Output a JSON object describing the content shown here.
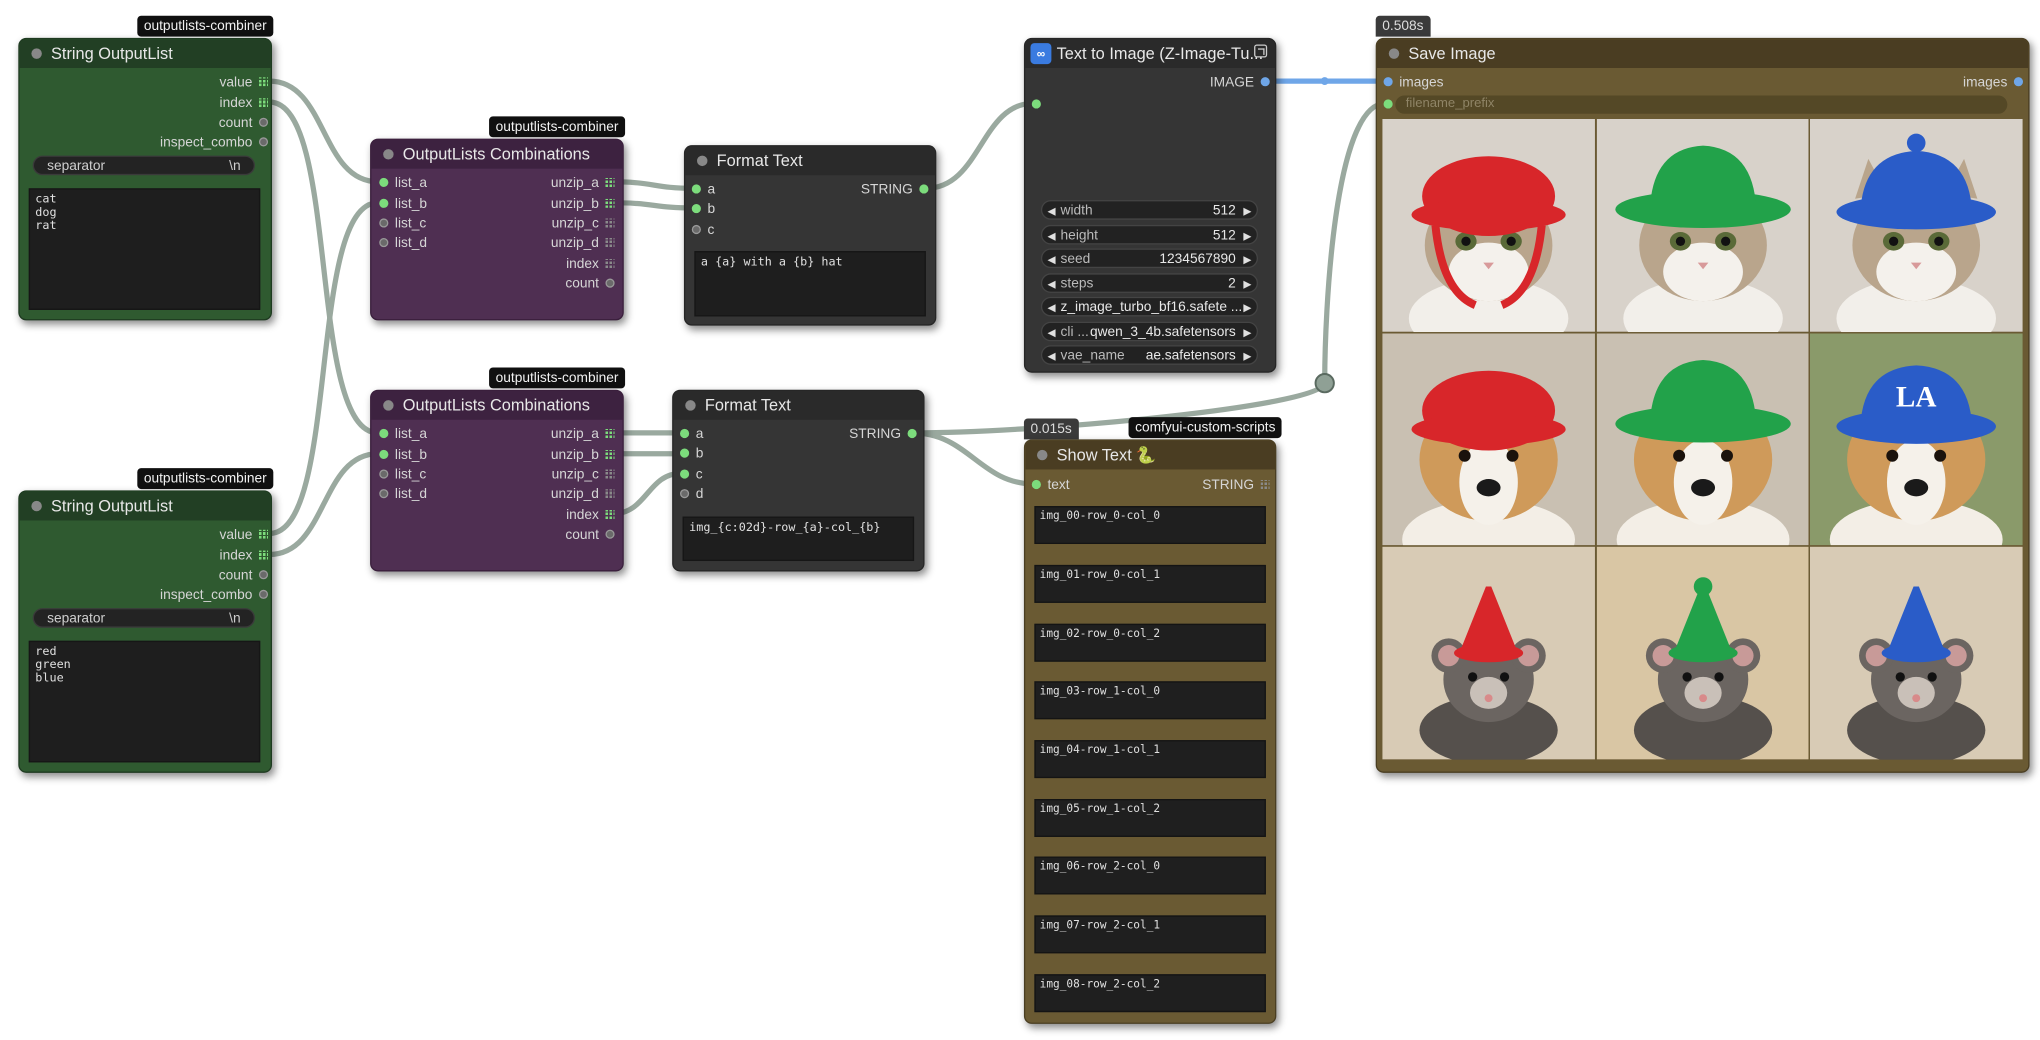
{
  "nodes": {
    "string_list_1": {
      "tag": "outputlists-combiner",
      "title": "String OutputList",
      "outputs": [
        "value",
        "index",
        "count",
        "inspect_combo"
      ],
      "separator_label": "separator",
      "separator_value": "\\n",
      "text": "cat\ndog\nrat"
    },
    "string_list_2": {
      "tag": "outputlists-combiner",
      "title": "String OutputList",
      "outputs": [
        "value",
        "index",
        "count",
        "inspect_combo"
      ],
      "separator_label": "separator",
      "separator_value": "\\n",
      "text": "red\ngreen\nblue"
    },
    "combinations_1": {
      "tag": "outputlists-combiner",
      "title": "OutputLists Combinations",
      "inputs": [
        "list_a",
        "list_b",
        "list_c",
        "list_d"
      ],
      "outputs": [
        "unzip_a",
        "unzip_b",
        "unzip_c",
        "unzip_d",
        "index",
        "count"
      ]
    },
    "combinations_2": {
      "tag": "outputlists-combiner",
      "title": "OutputLists Combinations",
      "inputs": [
        "list_a",
        "list_b",
        "list_c",
        "list_d"
      ],
      "outputs": [
        "unzip_a",
        "unzip_b",
        "unzip_c",
        "unzip_d",
        "index",
        "count"
      ]
    },
    "format_text_1": {
      "title": "Format Text",
      "inputs": [
        "a",
        "b",
        "c"
      ],
      "output": "STRING",
      "text": "a {a} with a {b} hat"
    },
    "format_text_2": {
      "title": "Format Text",
      "inputs": [
        "a",
        "b",
        "c",
        "d"
      ],
      "output": "STRING",
      "text": "img_{c:02d}-row_{a}-col_{b}"
    },
    "text_to_image": {
      "title": "Text to Image (Z-Image-Tu...",
      "output": "IMAGE",
      "widgets": [
        {
          "label": "width",
          "value": "512"
        },
        {
          "label": "height",
          "value": "512"
        },
        {
          "label": "seed",
          "value": "1234567890"
        },
        {
          "label": "steps",
          "value": "2"
        },
        {
          "label": "",
          "value": "z_image_turbo_bf16.safete ..."
        },
        {
          "label": "cli ...",
          "value": "qwen_3_4b.safetensors"
        },
        {
          "label": "vae_name",
          "value": "ae.safetensors"
        }
      ]
    },
    "show_text": {
      "time": "0.015s",
      "tag": "comfyui-custom-scripts",
      "title": "Show Text",
      "input": "text",
      "output": "STRING",
      "entries": [
        "img_00-row_0-col_0",
        "img_01-row_0-col_1",
        "img_02-row_0-col_2",
        "img_03-row_1-col_0",
        "img_04-row_1-col_1",
        "img_05-row_1-col_2",
        "img_06-row_2-col_0",
        "img_07-row_2-col_1",
        "img_08-row_2-col_2"
      ]
    },
    "save_image": {
      "time": "0.508s",
      "title": "Save Image",
      "input": "images",
      "output": "images",
      "prefix_placeholder": "filename_prefix",
      "images": [
        {
          "animal": "cat",
          "hat": "red"
        },
        {
          "animal": "cat",
          "hat": "green"
        },
        {
          "animal": "cat",
          "hat": "blue"
        },
        {
          "animal": "dog",
          "hat": "red"
        },
        {
          "animal": "dog",
          "hat": "green"
        },
        {
          "animal": "dog",
          "hat": "blue",
          "logo": "LA"
        },
        {
          "animal": "rat",
          "hat": "red"
        },
        {
          "animal": "rat",
          "hat": "green"
        },
        {
          "animal": "rat",
          "hat": "blue"
        }
      ]
    }
  },
  "colors": {
    "hat_red": "#d8262a",
    "hat_green": "#22a24a",
    "hat_blue": "#2a5cc8",
    "wire": "#8fa095",
    "image_wire": "#6fa6e8",
    "node_green": "#2f5a30",
    "node_purple": "#4f2f52",
    "node_dark": "#353535",
    "node_brown": "#6a5a33"
  }
}
